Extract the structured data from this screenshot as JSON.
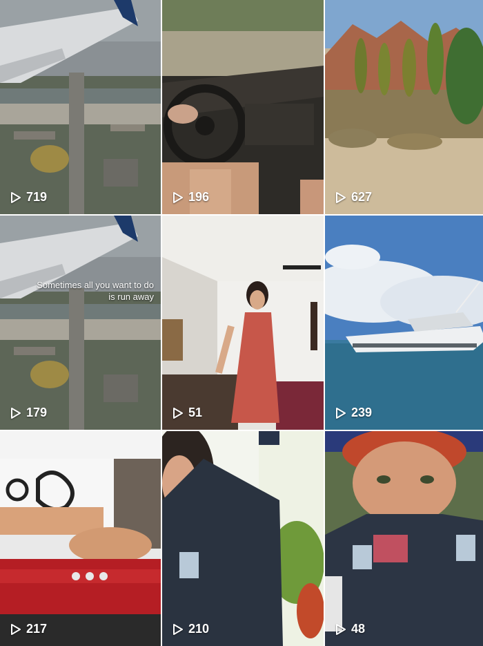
{
  "tiles": [
    {
      "views": "719",
      "caption": "",
      "icon": "play-icon",
      "scene": "airplane-wing-over-city"
    },
    {
      "views": "196",
      "caption": "",
      "icon": "play-icon",
      "scene": "car-interior-steering-wheel"
    },
    {
      "views": "627",
      "caption": "",
      "icon": "play-icon",
      "scene": "desert-mountains-trees"
    },
    {
      "views": "179",
      "caption": "Sometimes all you want to do is run away",
      "icon": "play-icon",
      "scene": "airplane-wing-over-city"
    },
    {
      "views": "51",
      "caption": "",
      "icon": "play-icon",
      "scene": "person-in-red-dress-room"
    },
    {
      "views": "239",
      "caption": "",
      "icon": "play-icon",
      "scene": "yacht-on-water"
    },
    {
      "views": "217",
      "caption": "",
      "icon": "play-icon",
      "scene": "hands-on-red-synthesizer"
    },
    {
      "views": "210",
      "caption": "",
      "icon": "play-icon",
      "scene": "selfie-dark-jacket-plants"
    },
    {
      "views": "48",
      "caption": "",
      "icon": "play-icon",
      "scene": "closeup-selfie-jacket"
    }
  ],
  "colors": {
    "text": "#ffffff",
    "background": "#ffffff"
  }
}
